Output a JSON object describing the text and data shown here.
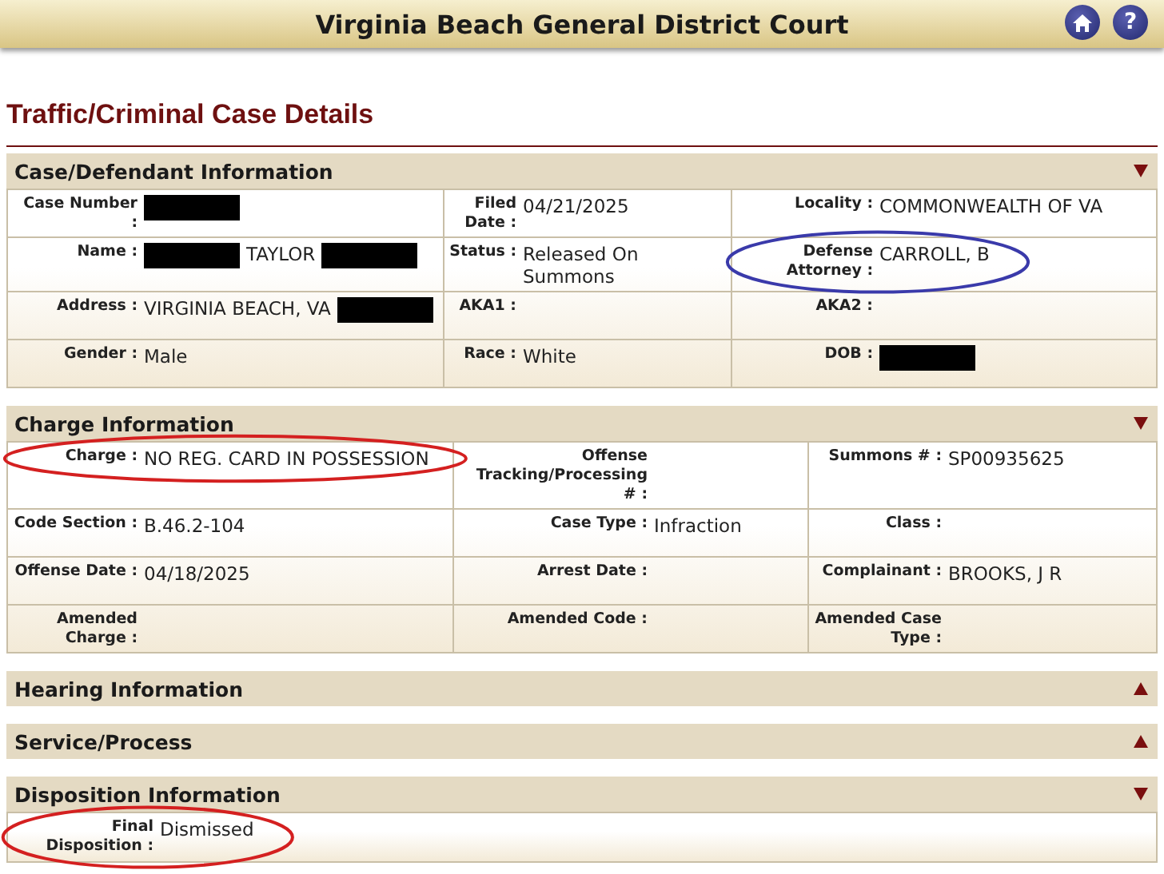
{
  "header": {
    "title": "Virginia Beach General District Court",
    "help_label": "?"
  },
  "page_title": "Traffic/Criminal Case Details",
  "sections": [
    {
      "title": "Case/Defendant Information",
      "expanded": true,
      "rows": [
        [
          {
            "label": "Case Number :",
            "value": [
              {
                "kind": "redacted"
              }
            ]
          },
          {
            "label": "Filed Date :",
            "value": [
              {
                "kind": "text",
                "text": "04/21/2025"
              }
            ]
          },
          {
            "label": "Locality :",
            "value": [
              {
                "kind": "text",
                "text": "COMMONWEALTH OF VA"
              }
            ]
          }
        ],
        [
          {
            "label": "Name :",
            "value": [
              {
                "kind": "redacted"
              },
              {
                "kind": "text",
                "text": "TAYLOR"
              },
              {
                "kind": "redacted"
              }
            ]
          },
          {
            "label": "Status :",
            "value": [
              {
                "kind": "text",
                "text": "Released On Summons"
              }
            ]
          },
          {
            "label": "Defense Attorney :",
            "value": [
              {
                "kind": "text",
                "text": "CARROLL, B"
              }
            ],
            "color": "#3a3aaa"
          }
        ],
        [
          {
            "label": "Address :",
            "value": [
              {
                "kind": "text",
                "text": "VIRGINIA BEACH, VA"
              },
              {
                "kind": "redacted"
              }
            ]
          },
          {
            "label": "AKA1 :"
          },
          {
            "label": "AKA2 :"
          }
        ],
        [
          {
            "label": "Gender :",
            "value": [
              {
                "kind": "text",
                "text": "Male"
              }
            ]
          },
          {
            "label": "Race :",
            "value": [
              {
                "kind": "text",
                "text": "White"
              }
            ]
          },
          {
            "label": "DOB :",
            "value": [
              {
                "kind": "redacted"
              }
            ]
          }
        ]
      ]
    },
    {
      "title": "Charge Information",
      "expanded": true,
      "rows": [
        [
          {
            "label": "Charge :",
            "value": [
              {
                "kind": "text",
                "text": "NO REG. CARD IN POSSESSION"
              }
            ],
            "color": "#d42020"
          },
          {
            "label": "Offense Tracking/Processing # :"
          },
          {
            "label": "Summons # :",
            "value": [
              {
                "kind": "text",
                "text": "SP00935625"
              }
            ]
          }
        ],
        [
          {
            "label": "Code Section :",
            "value": [
              {
                "kind": "text",
                "text": "B.46.2-104"
              }
            ]
          },
          {
            "label": "Case Type :",
            "value": [
              {
                "kind": "text",
                "text": "Infraction"
              }
            ]
          },
          {
            "label": "Class :"
          }
        ],
        [
          {
            "label": "Offense Date :",
            "value": [
              {
                "kind": "text",
                "text": "04/18/2025"
              }
            ]
          },
          {
            "label": "Arrest Date :"
          },
          {
            "label": "Complainant :",
            "value": [
              {
                "kind": "text",
                "text": "BROOKS, J R"
              }
            ]
          }
        ],
        [
          {
            "label": "Amended Charge :"
          },
          {
            "label": "Amended Code :"
          },
          {
            "label": "Amended Case Type :"
          }
        ]
      ]
    },
    {
      "title": "Hearing Information",
      "expanded": false
    },
    {
      "title": "Service/Process",
      "expanded": false
    },
    {
      "title": "Disposition Information",
      "expanded": true,
      "rows": [
        [
          {
            "label": "Final Disposition :",
            "value": [
              {
                "kind": "text",
                "text": "Dismissed"
              }
            ],
            "color": "#d42020"
          }
        ]
      ]
    }
  ]
}
